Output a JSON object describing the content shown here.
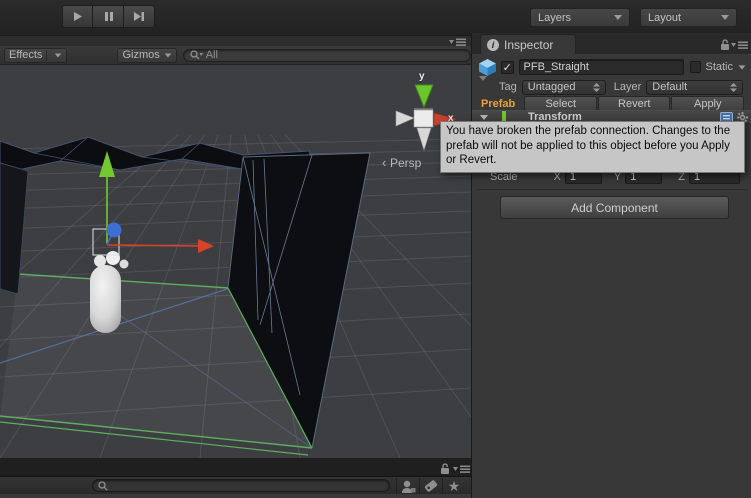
{
  "toolbar": {
    "layers_label": "Layers",
    "layout_label": "Layout"
  },
  "scene": {
    "toolbar": {
      "effects_label": "Effects",
      "gizmos_label": "Gizmos",
      "search_value": "All"
    },
    "orientation_gizmo": {
      "y_label": "y",
      "x_label": "x",
      "persp_label": "Persp"
    },
    "colors": {
      "axis_x": "#d9422a",
      "axis_y": "#74c92e",
      "axis_z": "#3d6fd2",
      "wireframe_green": "#5fae5f",
      "wireframe_blue": "#5a74a8"
    }
  },
  "inspector": {
    "tab_label": "Inspector",
    "header": {
      "name_value": "PFB_Straight",
      "static_label": "Static",
      "tag_label": "Tag",
      "tag_value": "Untagged",
      "layer_label": "Layer",
      "layer_value": "Default"
    },
    "prefab_bar": {
      "prefab_label": "Prefab",
      "prefab_color": "#e9a23b",
      "select_label": "Select",
      "revert_label": "Revert",
      "apply_label": "Apply"
    },
    "transform": {
      "title": "Transform",
      "scale_label": "Scale",
      "x_label": "X",
      "x_value": "1",
      "y_label": "Y",
      "y_value": "1",
      "z_label": "Z",
      "z_value": "1"
    },
    "add_component_label": "Add Component",
    "tooltip_text": "You have broken the prefab connection. Changes to the prefab will not be applied to this object before you Apply or Revert."
  }
}
